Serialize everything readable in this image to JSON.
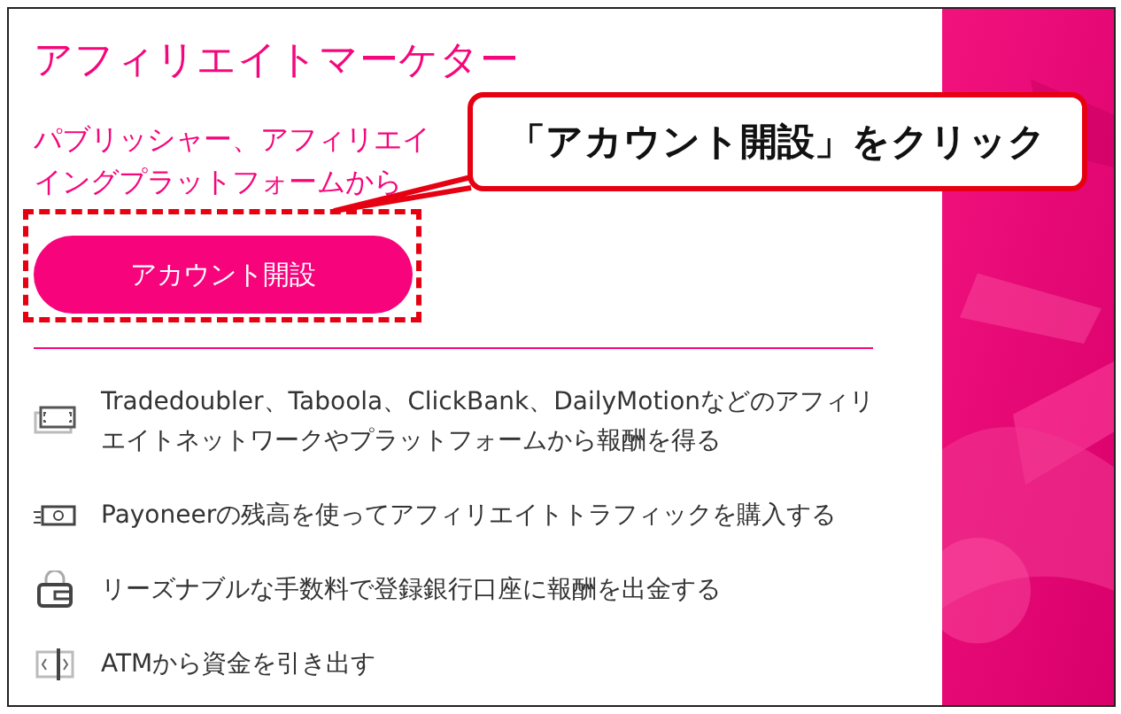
{
  "card": {
    "title": "アフィリエイトマーケター",
    "subtitle_lines": [
      "パブリッシャー、アフィリエイ",
      "イングプラットフォームから"
    ],
    "button": "アカウント開設",
    "features": [
      {
        "kind": "cash",
        "text": "Tradedoubler、Taboola、ClickBank、DailyMotionなどのアフィリエイトネットワークやプラットフォームから報酬を得る"
      },
      {
        "kind": "payment",
        "text": "Payoneerの残高を使ってアフィリエイトトラフィックを購入する"
      },
      {
        "kind": "wallet",
        "text": "リーズナブルな手数料で登録銀行口座に報酬を出金する"
      },
      {
        "kind": "atm",
        "text": "ATMから資金を引き出す"
      }
    ]
  },
  "callout": {
    "text": "「アカウント開設」をクリック"
  }
}
